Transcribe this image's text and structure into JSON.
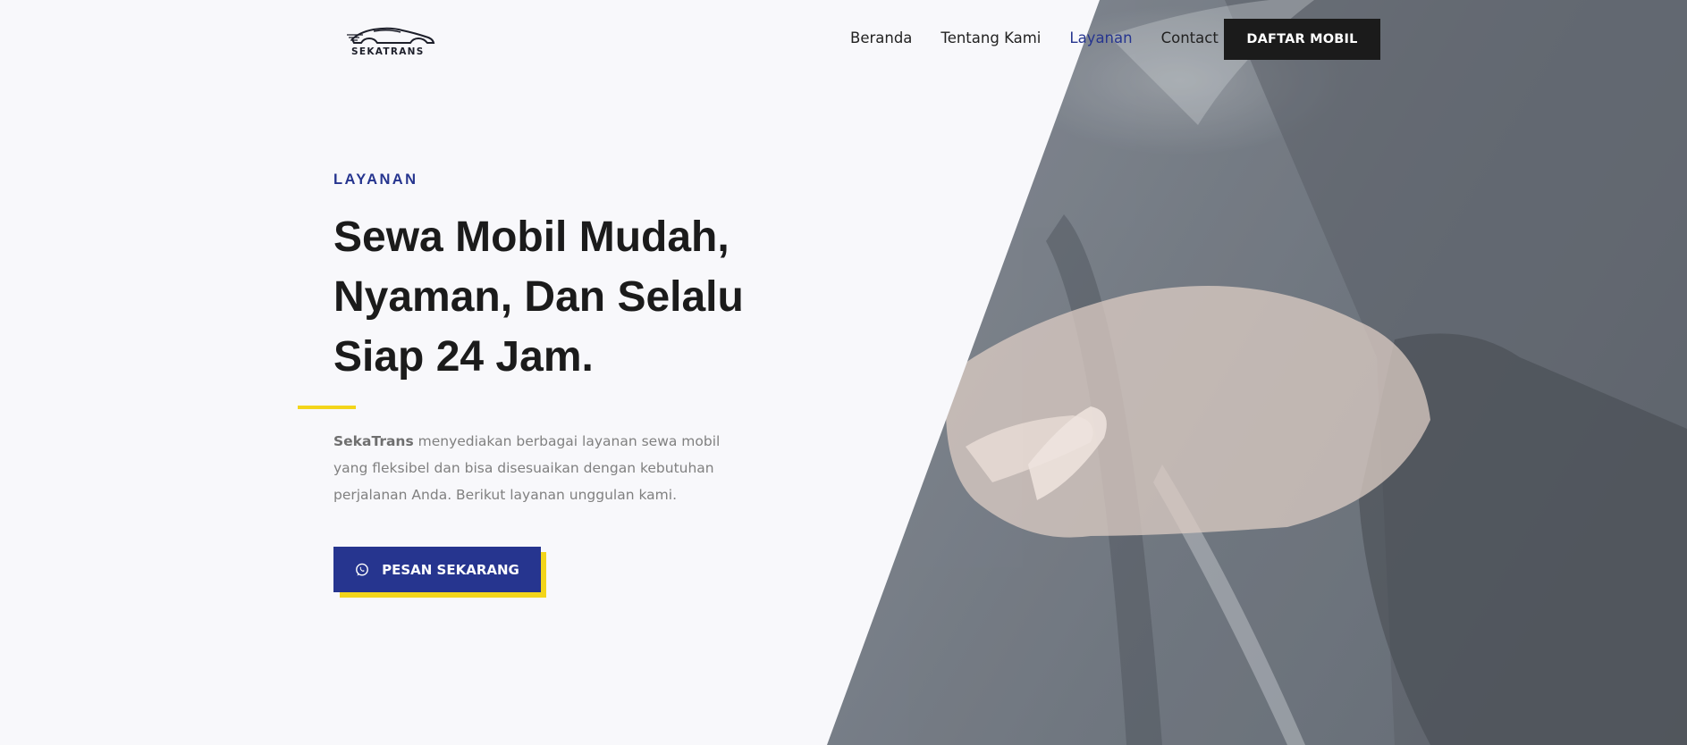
{
  "header": {
    "logo_text": "SEKATRANS",
    "nav": [
      {
        "label": "Beranda",
        "active": false
      },
      {
        "label": "Tentang Kami",
        "active": false
      },
      {
        "label": "Layanan",
        "active": true
      },
      {
        "label": "Contact",
        "active": false
      }
    ],
    "cta_label": "DAFTAR MOBIL"
  },
  "hero": {
    "eyebrow": "LAYANAN",
    "headline_lines": [
      "Sewa Mobil Mudah,",
      "Nyaman, Dan Selalu",
      "Siap 24 Jam."
    ],
    "description_brand": "SekaTrans",
    "description_rest": " menyediakan berbagai layanan sewa mobil yang fleksibel dan bisa disesuaikan dengan kebutuhan perjalanan Anda. Berikut layanan unggulan kami.",
    "cta_label": "PESAN SEKARANG",
    "cta_icon": "whatsapp-icon"
  },
  "colors": {
    "primary": "#26358f",
    "accent": "#f3d51a",
    "dark": "#1b1b1b",
    "background": "#f8f8fb"
  }
}
